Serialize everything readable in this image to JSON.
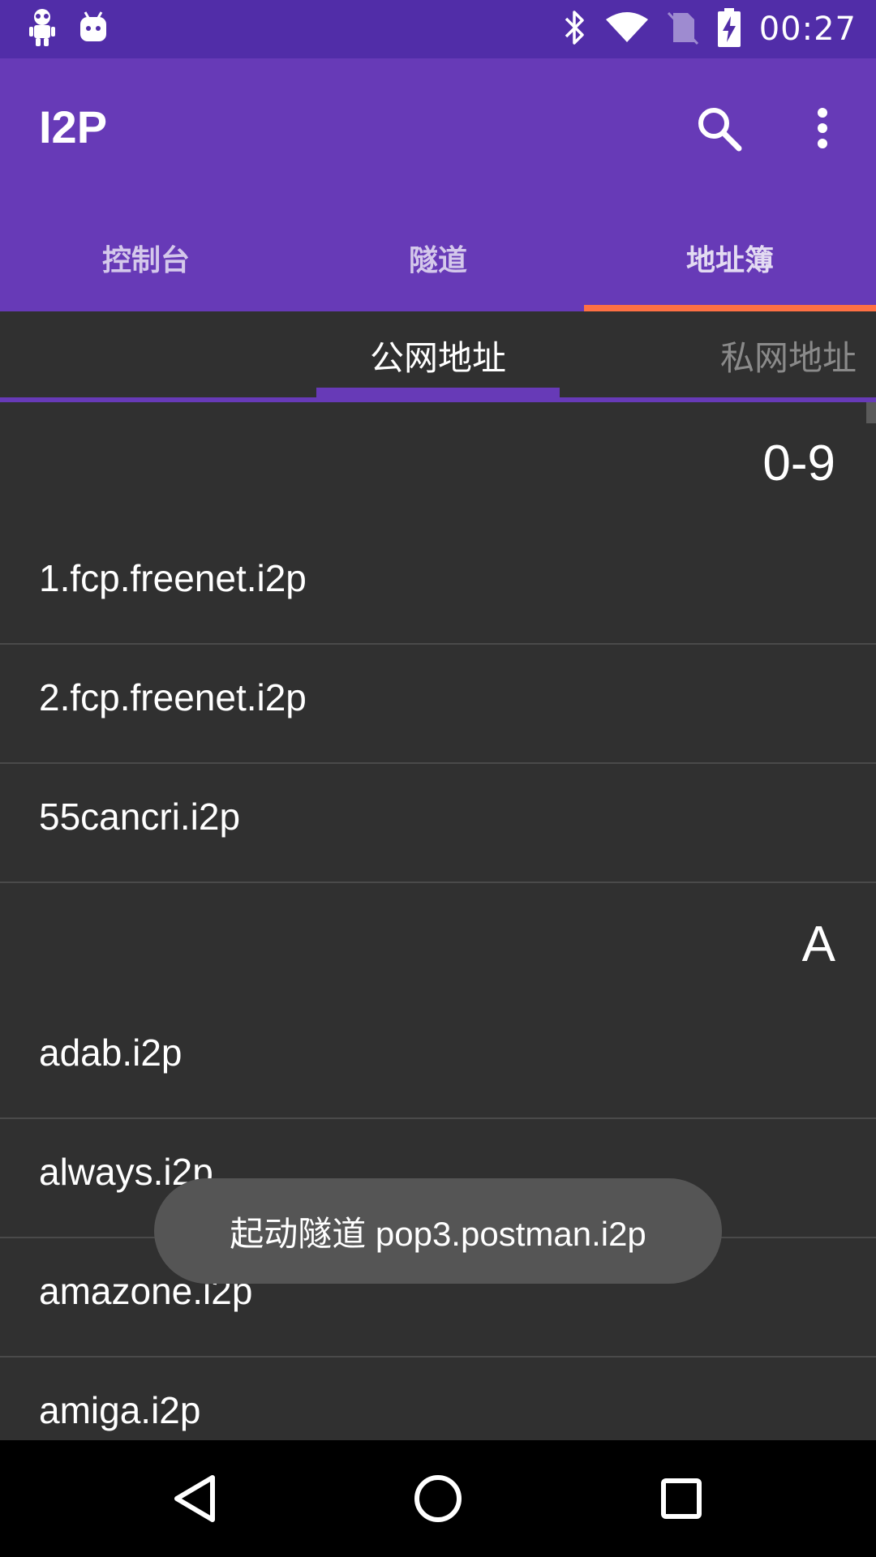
{
  "status_bar": {
    "time": "00:27",
    "icons": [
      "android-robot-icon",
      "android-debug-icon",
      "bluetooth-icon",
      "wifi-icon",
      "no-sim-icon",
      "battery-charging-icon"
    ]
  },
  "app_bar": {
    "title": "I2P",
    "search_icon": "search-icon",
    "overflow_icon": "more-vert-icon",
    "accent_color": "#673AB7",
    "status_color": "#512DA8",
    "indicator_color": "#FF7043"
  },
  "tabs": [
    {
      "label": "控制台"
    },
    {
      "label": "隧道"
    },
    {
      "label": "地址簿",
      "active": true
    }
  ],
  "sub_tabs": [
    {
      "label": "公网地址",
      "active": true
    },
    {
      "label": "私网地址"
    }
  ],
  "list": {
    "sections": [
      {
        "header": "0-9",
        "items": [
          "1.fcp.freenet.i2p",
          "2.fcp.freenet.i2p",
          "55cancri.i2p"
        ]
      },
      {
        "header": "A",
        "items": [
          "adab.i2p",
          "always.i2p",
          "amazone.i2p",
          "amiga.i2p"
        ]
      }
    ]
  },
  "toast": {
    "text": "起动隧道 pop3.postman.i2p"
  },
  "nav_bar": {
    "icons": [
      "back-icon",
      "home-icon",
      "recents-icon"
    ]
  }
}
